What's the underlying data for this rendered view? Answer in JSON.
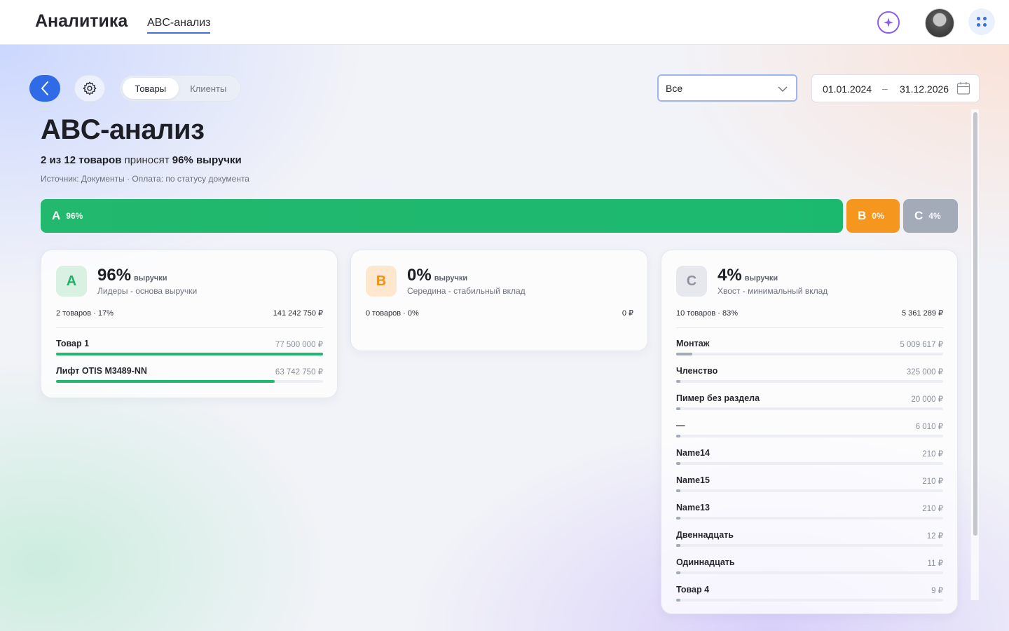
{
  "topbar": {
    "app_title": "Аналитика",
    "breadcrumb": "ABC-анализ",
    "accent_color": "#3f6fd8"
  },
  "toolbar": {
    "tabs": [
      {
        "label": "Товары",
        "active": true
      },
      {
        "label": "Клиенты",
        "active": false
      }
    ],
    "filter_select": {
      "value": "Все"
    },
    "date_range": {
      "from": "01.01.2024",
      "separator": "–",
      "to": "31.12.2026"
    }
  },
  "header": {
    "title": "ABC-анализ",
    "summary_count": "2 из 12 товаров",
    "summary_mid": " приносят ",
    "summary_share": "96% выручки",
    "source": "Источник: Документы · Оплата: по статусу документа"
  },
  "distribution": [
    {
      "letter": "A",
      "pct": "96%",
      "share": 0.96,
      "color": "#1bb96e"
    },
    {
      "letter": "B",
      "pct": "0%",
      "share": 0.0,
      "color": "#f5961e"
    },
    {
      "letter": "C",
      "pct": "4%",
      "share": 0.04,
      "color": "#a3aab8"
    }
  ],
  "cards": [
    {
      "letter": "A",
      "pct": "96%",
      "pct_label": "выручки",
      "description": "Лидеры - основа выручки",
      "meta": "2 товаров · 17%",
      "sum": "141 242 750 ₽",
      "items": [
        {
          "name": "Товар 1",
          "value": "77 500 000 ₽",
          "share": 1.0
        },
        {
          "name": "Лифт OTIS M3489-NN",
          "value": "63 742 750 ₽",
          "share": 0.82
        }
      ]
    },
    {
      "letter": "B",
      "pct": "0%",
      "pct_label": "выручки",
      "description": "Середина - стабильный вклад",
      "meta": "0 товаров · 0%",
      "sum": "0 ₽",
      "items": []
    },
    {
      "letter": "C",
      "pct": "4%",
      "pct_label": "выручки",
      "description": "Хвост - минимальный вклад",
      "meta": "10 товаров · 83%",
      "sum": "5 361 289 ₽",
      "items": [
        {
          "name": "Монтаж",
          "value": "5 009 617 ₽",
          "share": 0.06
        },
        {
          "name": "Членство",
          "value": "325 000 ₽",
          "share": 0.004
        },
        {
          "name": "Пимер без раздела",
          "value": "20 000 ₽",
          "share": 0.001
        },
        {
          "name": "—",
          "value": "6 010 ₽",
          "share": 0.0001
        },
        {
          "name": "Name14",
          "value": "210 ₽",
          "share": 0.0
        },
        {
          "name": "Name15",
          "value": "210 ₽",
          "share": 0.0
        },
        {
          "name": "Name13",
          "value": "210 ₽",
          "share": 0.0
        },
        {
          "name": "Двеннадцать",
          "value": "12 ₽",
          "share": 0.0
        },
        {
          "name": "Одиннадцать",
          "value": "11 ₽",
          "share": 0.0
        },
        {
          "name": "Товар 4",
          "value": "9 ₽",
          "share": 0.0
        }
      ]
    }
  ]
}
